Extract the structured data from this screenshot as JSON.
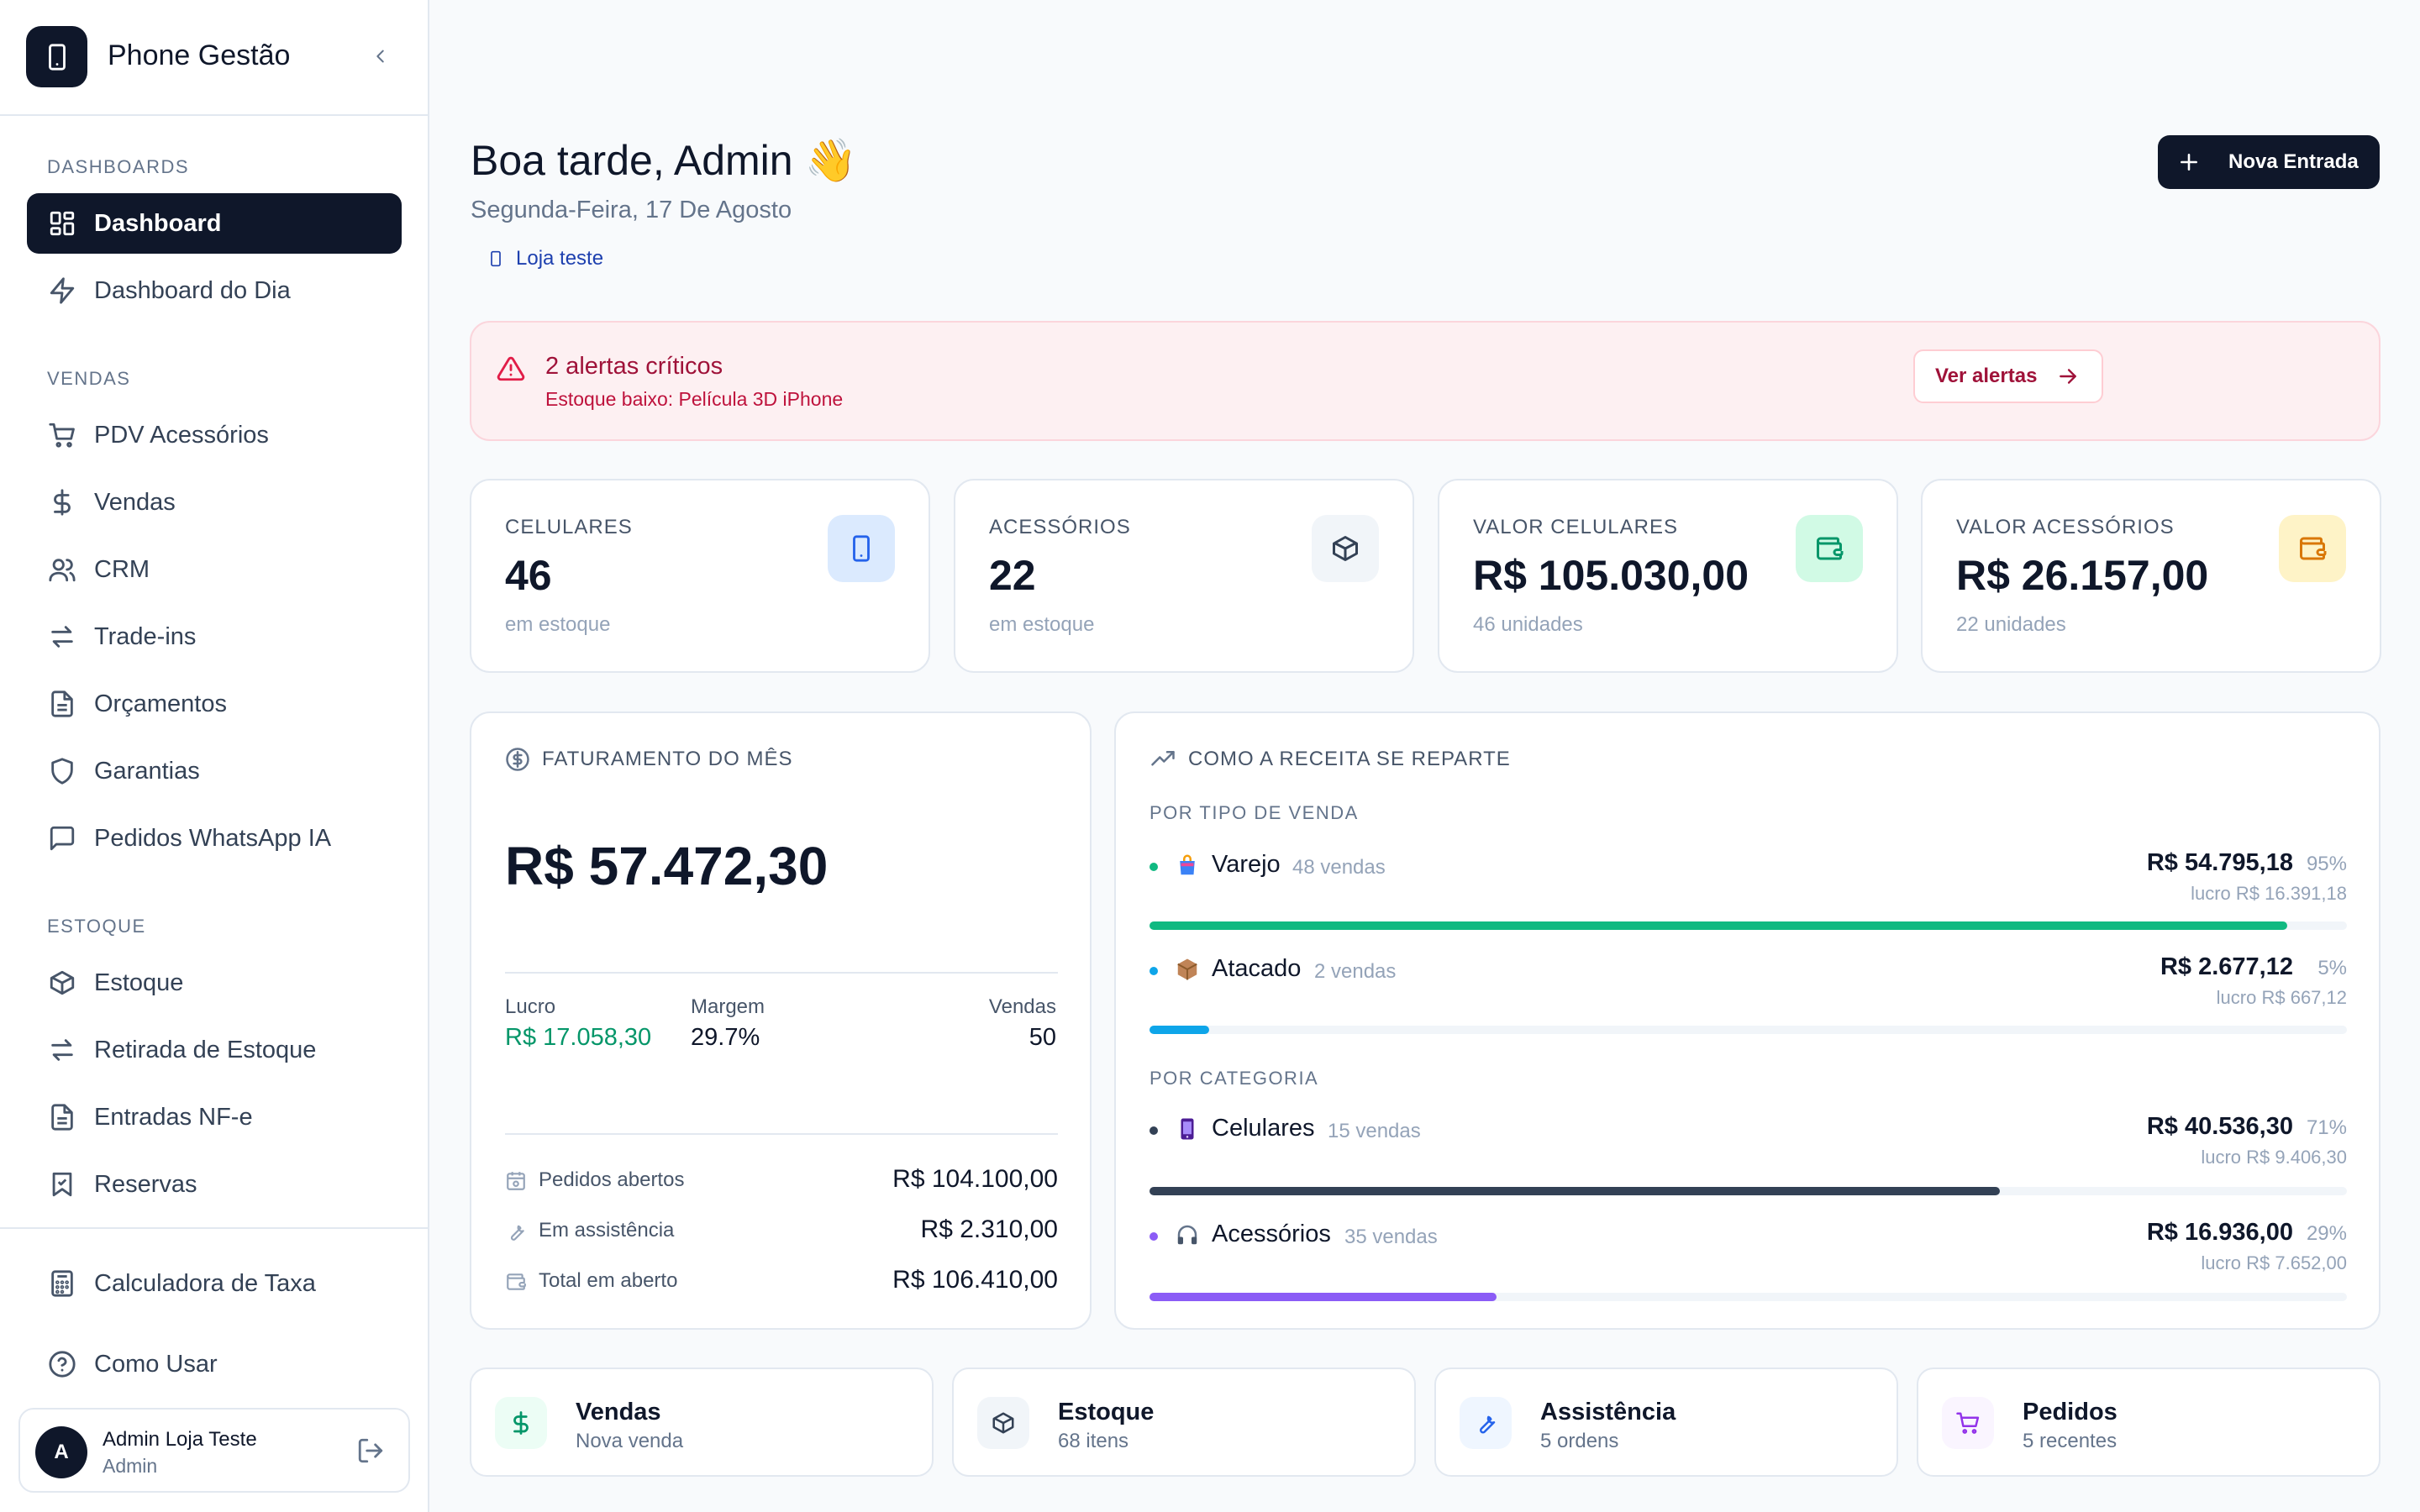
{
  "sidebar": {
    "brand": "Phone Gestão",
    "sections": {
      "dashboards": "DASHBOARDS",
      "vendas": "VENDAS",
      "estoque": "ESTOQUE"
    },
    "items": [
      {
        "label": "Dashboard",
        "icon": "grid-icon",
        "active": true
      },
      {
        "label": "Dashboard do Dia",
        "icon": "bolt-icon"
      },
      {
        "label": "PDV Acessórios",
        "icon": "cart-icon"
      },
      {
        "label": "Vendas",
        "icon": "dollar-icon"
      },
      {
        "label": "CRM",
        "icon": "users-icon"
      },
      {
        "label": "Trade-ins",
        "icon": "swap-icon"
      },
      {
        "label": "Orçamentos",
        "icon": "document-icon"
      },
      {
        "label": "Garantias",
        "icon": "shield-icon"
      },
      {
        "label": "Pedidos WhatsApp IA",
        "icon": "message-icon"
      },
      {
        "label": "Estoque",
        "icon": "box-icon"
      },
      {
        "label": "Retirada de Estoque",
        "icon": "swap-icon"
      },
      {
        "label": "Entradas NF-e",
        "icon": "document-icon"
      },
      {
        "label": "Reservas",
        "icon": "bookmark-icon"
      },
      {
        "label": "Calculadora de Taxa",
        "icon": "calculator-icon"
      },
      {
        "label": "Como Usar",
        "icon": "help-icon"
      }
    ],
    "user": {
      "initial": "A",
      "name": "Admin Loja Teste",
      "role": "Admin"
    }
  },
  "header": {
    "greeting": "Boa tarde, Admin 👋",
    "date": "Segunda-Feira, 17 De Agosto",
    "store": "Loja teste",
    "new_button": "Nova Entrada"
  },
  "alert": {
    "title": "2 alertas críticos",
    "message": "Estoque baixo: Película 3D iPhone",
    "button": "Ver alertas"
  },
  "stats": [
    {
      "label": "CELULARES",
      "value": "46",
      "sub": "em estoque",
      "icon": "phone-icon",
      "color": "#2563eb"
    },
    {
      "label": "ACESSÓRIOS",
      "value": "22",
      "sub": "em estoque",
      "icon": "box-icon",
      "color": "#334155"
    },
    {
      "label": "VALOR CELULARES",
      "value": "R$ 105.030,00",
      "sub": "46 unidades",
      "icon": "wallet-icon",
      "color": "#059669"
    },
    {
      "label": "VALOR ACESSÓRIOS",
      "value": "R$ 26.157,00",
      "sub": "22 unidades",
      "icon": "wallet-icon",
      "color": "#d97706"
    }
  ],
  "faturamento": {
    "title": "FATURAMENTO DO MÊS",
    "total": "R$ 57.472,30",
    "lucro_label": "Lucro",
    "lucro": "R$ 17.058,30",
    "margem_label": "Margem",
    "margem": "29.7%",
    "vendas_label": "Vendas",
    "vendas": "50",
    "rows": [
      {
        "label": "Pedidos abertos",
        "value": "R$ 104.100,00",
        "icon": "calendar-icon"
      },
      {
        "label": "Em assistência",
        "value": "R$ 2.310,00",
        "icon": "wrench-icon"
      },
      {
        "label": "Total em aberto",
        "value": "R$ 106.410,00",
        "icon": "wallet-icon"
      }
    ]
  },
  "receita": {
    "title": "COMO A RECEITA SE REPARTE",
    "tipo_title": "POR TIPO DE VENDA",
    "categoria_title": "POR CATEGORIA",
    "tipo": [
      {
        "name": "Varejo",
        "count": "48 vendas",
        "amount": "R$ 54.795,18",
        "pct": "95%",
        "lucro": "lucro R$ 16.391,18",
        "share": 95,
        "color": "#10b981",
        "icon": "shopping-bag-icon"
      },
      {
        "name": "Atacado",
        "count": "2 vendas",
        "amount": "R$ 2.677,12",
        "pct": "5%",
        "lucro": "lucro R$ 667,12",
        "share": 5,
        "color": "#0ea5e9",
        "icon": "package-icon"
      }
    ],
    "categoria": [
      {
        "name": "Celulares",
        "count": "15 vendas",
        "amount": "R$ 40.536,30",
        "pct": "71%",
        "lucro": "lucro R$ 9.406,30",
        "share": 71,
        "color": "#334155",
        "icon": "phone-icon"
      },
      {
        "name": "Acessórios",
        "count": "35 vendas",
        "amount": "R$ 16.936,00",
        "pct": "29%",
        "lucro": "lucro R$ 7.652,00",
        "share": 29,
        "color": "#8b5cf6",
        "icon": "headphones-icon"
      }
    ]
  },
  "quick": [
    {
      "title": "Vendas",
      "sub": "Nova venda",
      "icon": "dollar-icon",
      "color": "#059669"
    },
    {
      "title": "Estoque",
      "sub": "68 itens",
      "icon": "box-icon",
      "color": "#334155"
    },
    {
      "title": "Assistência",
      "sub": "5 ordens",
      "icon": "wrench-icon",
      "color": "#2563eb"
    },
    {
      "title": "Pedidos",
      "sub": "5 recentes",
      "icon": "cart-icon",
      "color": "#9333ea"
    }
  ]
}
